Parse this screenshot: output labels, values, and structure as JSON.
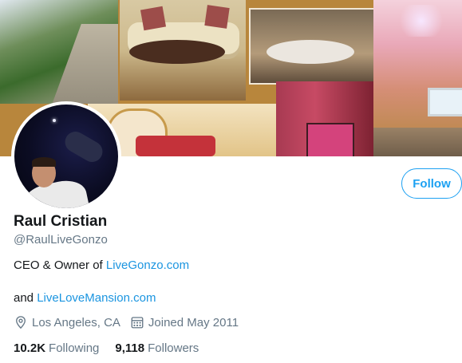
{
  "profile": {
    "name": "Raul Cristian",
    "handle": "@RaulLiveGonzo",
    "follow_label": "Follow",
    "bio_prefix": "CEO & Owner of ",
    "bio_link1": "LiveGonzo.com",
    "bio_line2_prefix": "and ",
    "bio_link2": "LiveLoveMansion.com",
    "location": "Los Angeles, CA",
    "joined": "Joined May 2011",
    "following_count": "10.2K",
    "following_label": "Following",
    "followers_count": "9,118",
    "followers_label": "Followers"
  },
  "icons": {
    "location": "location-pin-icon",
    "joined": "calendar-icon"
  },
  "colors": {
    "accent": "#1da1f2",
    "link": "#1b95e0",
    "secondary_text": "#657786",
    "primary_text": "#14171a"
  }
}
